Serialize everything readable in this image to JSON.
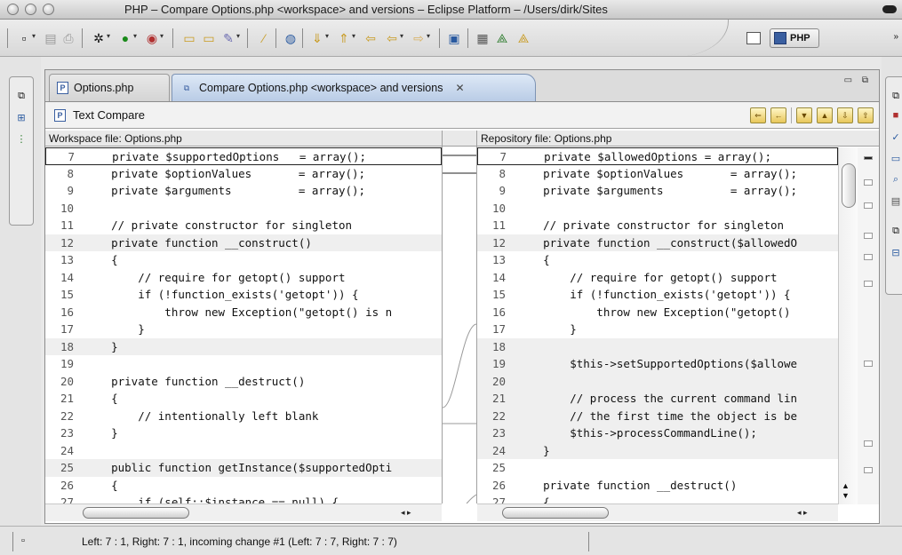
{
  "window": {
    "title": "PHP – Compare Options.php <workspace> and versions – Eclipse Platform – /Users/dirk/Sites"
  },
  "toolbar": {
    "perspective_label": "PHP",
    "icons": [
      "new-icon",
      "save-icon",
      "print-icon",
      "debug-icon",
      "run-icon",
      "external-tools-icon",
      "open-folder-icon",
      "open-project-icon",
      "pen-icon",
      "brush-icon",
      "globe-icon",
      "next-annotation-icon",
      "prev-annotation-icon",
      "last-edit-icon",
      "back-icon",
      "forward-icon",
      "open-type-icon",
      "open-task-icon",
      "team-icon",
      "synchronize-icon",
      "open-perspective-icon"
    ]
  },
  "tabs": [
    {
      "label": "Options.php",
      "icon": "php-file-icon",
      "active": false
    },
    {
      "label": "Compare Options.php <workspace> and versions",
      "icon": "compare-icon",
      "active": true
    }
  ],
  "compare": {
    "header": "Text Compare",
    "left_title": "Workspace file: Options.php",
    "right_title": "Repository file: Options.php"
  },
  "left_lines": [
    {
      "n": "7",
      "code": "    private $supportedOptions   = array();"
    },
    {
      "n": "8",
      "code": "    private $optionValues       = array();"
    },
    {
      "n": "9",
      "code": "    private $arguments          = array();"
    },
    {
      "n": "10",
      "code": ""
    },
    {
      "n": "11",
      "code": "    // private constructor for singleton"
    },
    {
      "n": "12",
      "code": "    private function __construct()"
    },
    {
      "n": "13",
      "code": "    {"
    },
    {
      "n": "14",
      "code": "        // require for getopt() support"
    },
    {
      "n": "15",
      "code": "        if (!function_exists('getopt')) {"
    },
    {
      "n": "16",
      "code": "            throw new Exception(\"getopt() is n"
    },
    {
      "n": "17",
      "code": "        }"
    },
    {
      "n": "18",
      "code": "    }"
    },
    {
      "n": "19",
      "code": ""
    },
    {
      "n": "20",
      "code": "    private function __destruct()"
    },
    {
      "n": "21",
      "code": "    {"
    },
    {
      "n": "22",
      "code": "        // intentionally left blank"
    },
    {
      "n": "23",
      "code": "    }"
    },
    {
      "n": "24",
      "code": ""
    },
    {
      "n": "25",
      "code": "    public function getInstance($supportedOpti"
    },
    {
      "n": "26",
      "code": "    {"
    },
    {
      "n": "27",
      "code": "        if (self::$instance == null) {"
    }
  ],
  "right_lines": [
    {
      "n": "7",
      "code": "    private $allowedOptions = array();"
    },
    {
      "n": "8",
      "code": "    private $optionValues       = array();"
    },
    {
      "n": "9",
      "code": "    private $arguments          = array();"
    },
    {
      "n": "10",
      "code": ""
    },
    {
      "n": "11",
      "code": "    // private constructor for singleton"
    },
    {
      "n": "12",
      "code": "    private function __construct($allowedO"
    },
    {
      "n": "13",
      "code": "    {"
    },
    {
      "n": "14",
      "code": "        // require for getopt() support"
    },
    {
      "n": "15",
      "code": "        if (!function_exists('getopt')) {"
    },
    {
      "n": "16",
      "code": "            throw new Exception(\"getopt()"
    },
    {
      "n": "17",
      "code": "        }"
    },
    {
      "n": "18",
      "code": ""
    },
    {
      "n": "19",
      "code": "        $this->setSupportedOptions($allowe"
    },
    {
      "n": "20",
      "code": ""
    },
    {
      "n": "21",
      "code": "        // process the current command lin"
    },
    {
      "n": "22",
      "code": "        // the first time the object is be"
    },
    {
      "n": "23",
      "code": "        $this->processCommandLine();"
    },
    {
      "n": "24",
      "code": "    }"
    },
    {
      "n": "25",
      "code": ""
    },
    {
      "n": "26",
      "code": "    private function __destruct()"
    },
    {
      "n": "27",
      "code": "    {"
    }
  ],
  "status": {
    "text": "Left: 7 : 1, Right: 7 : 1, incoming change #1 (Left: 7 : 7, Right: 7 : 7)"
  }
}
